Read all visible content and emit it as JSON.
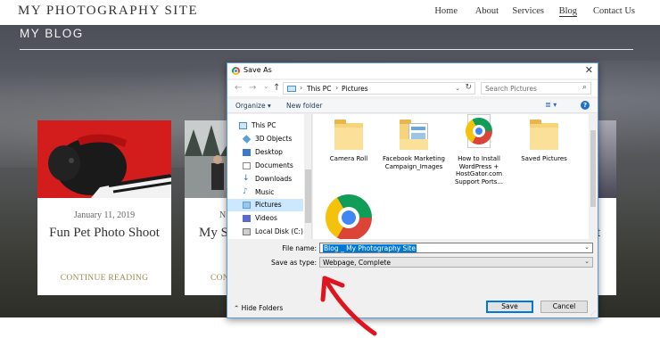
{
  "site": {
    "title": "MY PHOTOGRAPHY SITE",
    "nav": [
      {
        "label": "Home",
        "active": false
      },
      {
        "label": "About",
        "active": false
      },
      {
        "label": "Services",
        "active": false
      },
      {
        "label": "Blog",
        "active": true
      },
      {
        "label": "Contact Us",
        "active": false
      }
    ],
    "blog_heading": "MY BLOG"
  },
  "cards": [
    {
      "date": "January 11, 2019",
      "title": "Fun Pet Photo Shoot",
      "more": "CONTINUE READING"
    },
    {
      "date": "N",
      "title": "My S",
      "more": "CON"
    },
    {
      "date": "",
      "title": "t",
      "more": ""
    }
  ],
  "dialog": {
    "title": "Save As",
    "close": "✕",
    "address": {
      "crumbs": [
        "This PC",
        "Pictures"
      ],
      "separator": "›",
      "dropdown": "⌄",
      "refresh": "↻"
    },
    "nav_buttons": {
      "back": "←",
      "forward": "→",
      "dropdown": "⌄",
      "up": "↑"
    },
    "search": {
      "placeholder": "Search Pictures",
      "icon": "search-icon"
    },
    "toolbar": {
      "organize": "Organize ▾",
      "new_folder": "New folder",
      "view_icon": "≣ ▾",
      "help": "?"
    },
    "nav_items": [
      {
        "label": "This PC",
        "icon": "pc-icon",
        "color": "#4a90c8"
      },
      {
        "label": "3D Objects",
        "icon": "cube-icon",
        "color": "#5aa0d8"
      },
      {
        "label": "Desktop",
        "icon": "desktop-icon",
        "color": "#3a7ac8"
      },
      {
        "label": "Documents",
        "icon": "documents-icon",
        "color": "#8a8a8a"
      },
      {
        "label": "Downloads",
        "icon": "download-icon",
        "color": "#2a6db5"
      },
      {
        "label": "Music",
        "icon": "music-icon",
        "color": "#3a8ad8"
      },
      {
        "label": "Pictures",
        "icon": "pictures-icon",
        "color": "#5aa0d8",
        "selected": true
      },
      {
        "label": "Videos",
        "icon": "video-icon",
        "color": "#5a6ad0"
      },
      {
        "label": "Local Disk (C:)",
        "icon": "disk-icon",
        "color": "#777777"
      }
    ],
    "files": [
      {
        "name": "Camera Roll",
        "icon": "folder-icon"
      },
      {
        "name": "Facebook Marketing Campaign_Images",
        "icon": "folder-icon"
      },
      {
        "name": "How to Install WordPress + HostGator.com Support Ports...",
        "icon": "chrome-file-icon"
      },
      {
        "name": "Saved Pictures",
        "icon": "folder-icon"
      },
      {
        "name": "",
        "icon": "chrome-file-icon"
      }
    ],
    "fields": {
      "file_name_label": "File name:",
      "file_name_value": "Blog _ My Photography Site",
      "save_type_label": "Save as type:",
      "save_type_value": "Webpage, Complete",
      "dropdown": "⌄"
    },
    "footer": {
      "hide_folders": "⌃  Hide Folders",
      "save": "Save",
      "cancel": "Cancel"
    }
  },
  "colors": {
    "accent": "#0078d7",
    "annotation": "#e0141e",
    "link_gold": "#9a8a50"
  }
}
